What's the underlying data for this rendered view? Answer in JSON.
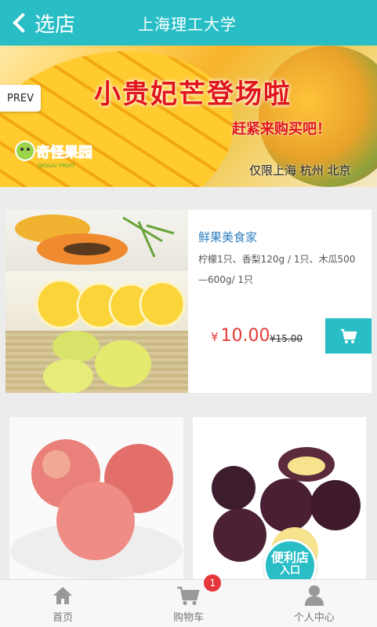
{
  "header": {
    "back_label": "选店",
    "title": "上海理工大学",
    "accent_color": "#29bec6"
  },
  "banner": {
    "headline": "小贵妃芒登场啦",
    "subline": "赶紧来购买吧！",
    "region": "仅限上海 杭州 北京",
    "logo_text": "奇怪果园",
    "logo_sub": "QIGUAI FRUIT",
    "prev_label": "PREV"
  },
  "featured_product": {
    "name": "鲜果美食家",
    "description": "柠檬1只、香梨120g / 1只、木瓜500—600g/ 1只",
    "currency": "¥",
    "price": "10.00",
    "original_price": "¥15.00",
    "cart_icon": "cart-icon"
  },
  "tiles": [
    {
      "icon": "apple-photo"
    },
    {
      "icon": "plum-photo"
    }
  ],
  "float_button": {
    "line1": "便利店",
    "line2": "入口"
  },
  "bottom_nav": {
    "items": [
      {
        "label": "首页",
        "icon": "home-icon"
      },
      {
        "label": "购物车",
        "icon": "cart-icon",
        "badge": "1"
      },
      {
        "label": "个人中心",
        "icon": "user-icon"
      }
    ],
    "badge_color": "#e5383b"
  }
}
